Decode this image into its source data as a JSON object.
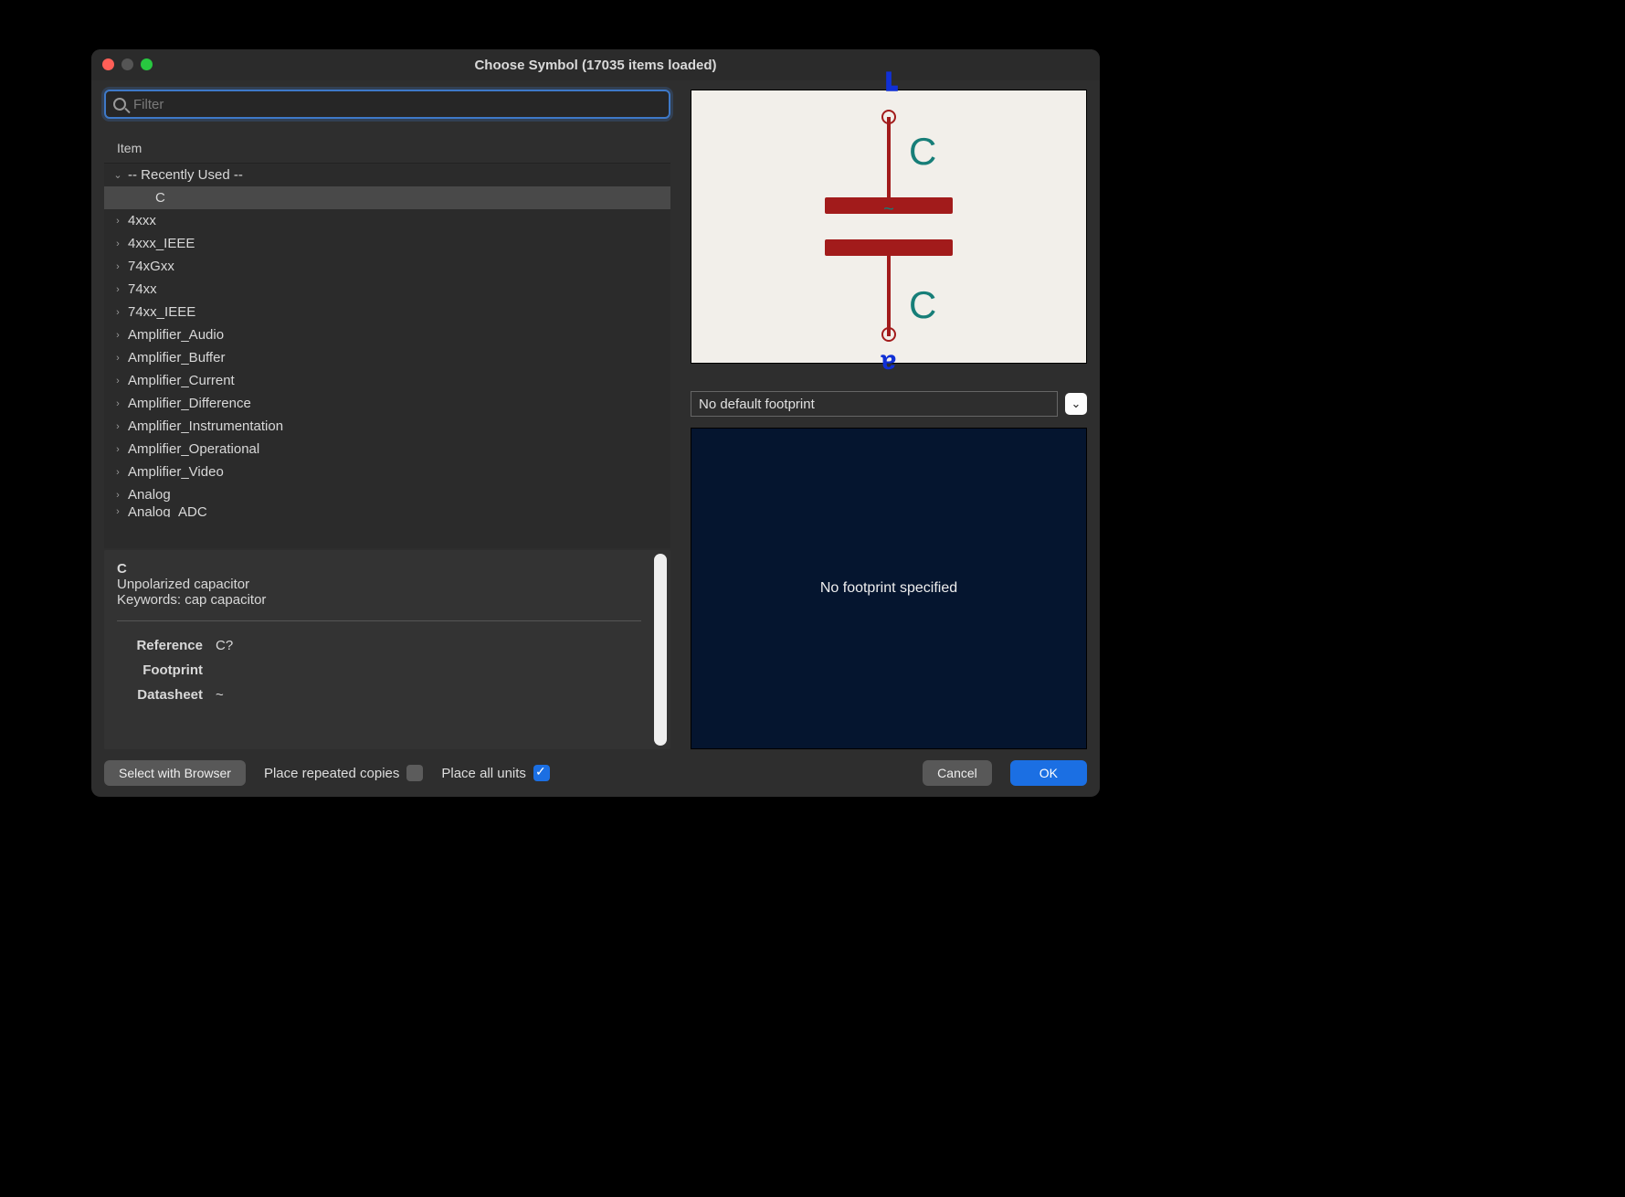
{
  "title": "Choose Symbol (17035 items loaded)",
  "search": {
    "placeholder": "Filter"
  },
  "tree_header": "Item",
  "tree": {
    "recent_label": "-- Recently Used --",
    "recent_items": [
      "C"
    ],
    "libs": [
      "4xxx",
      "4xxx_IEEE",
      "74xGxx",
      "74xx",
      "74xx_IEEE",
      "Amplifier_Audio",
      "Amplifier_Buffer",
      "Amplifier_Current",
      "Amplifier_Difference",
      "Amplifier_Instrumentation",
      "Amplifier_Operational",
      "Amplifier_Video",
      "Analog",
      "Analog_ADC"
    ]
  },
  "details": {
    "name": "C",
    "desc": "Unpolarized capacitor",
    "keywords": "Keywords: cap capacitor",
    "fields": {
      "reference_label": "Reference",
      "reference": "C?",
      "footprint_label": "Footprint",
      "footprint": "",
      "datasheet_label": "Datasheet",
      "datasheet": "~"
    }
  },
  "footprint_select": "No default footprint",
  "footprint_area": "No footprint specified",
  "footer": {
    "select_browser": "Select with Browser",
    "repeated": "Place repeated copies",
    "all_units": "Place all units",
    "cancel": "Cancel",
    "ok": "OK"
  },
  "preview_labels": {
    "top": "C",
    "bottom": "C"
  }
}
